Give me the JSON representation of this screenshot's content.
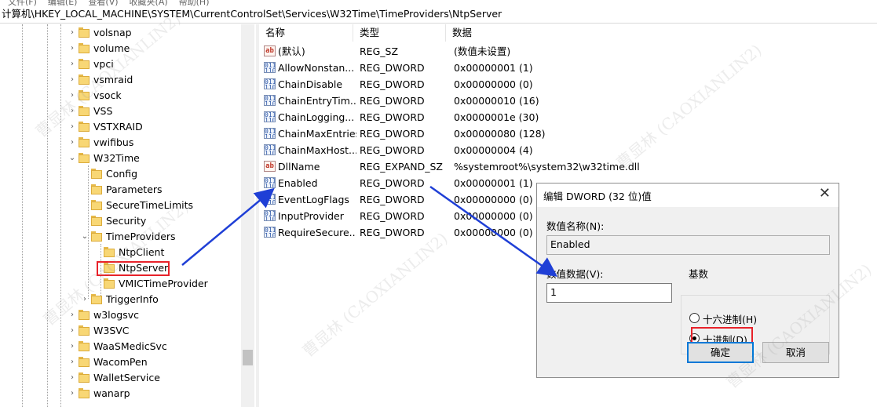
{
  "address": "计算机\\HKEY_LOCAL_MACHINE\\SYSTEM\\CurrentControlSet\\Services\\W32Time\\TimeProviders\\NtpServer",
  "menu": [
    "文件(F)",
    "编辑(E)",
    "查看(V)",
    "收藏夹(A)",
    "帮助(H)"
  ],
  "tree": {
    "items": [
      {
        "label": "volsnap"
      },
      {
        "label": "volume"
      },
      {
        "label": "vpci"
      },
      {
        "label": "vsmraid"
      },
      {
        "label": "vsock"
      },
      {
        "label": "VSS"
      },
      {
        "label": "VSTXRAID"
      },
      {
        "label": "vwifibus"
      },
      {
        "label": "W32Time"
      },
      {
        "label": "Config"
      },
      {
        "label": "Parameters"
      },
      {
        "label": "SecureTimeLimits"
      },
      {
        "label": "Security"
      },
      {
        "label": "TimeProviders"
      },
      {
        "label": "NtpClient"
      },
      {
        "label": "NtpServer"
      },
      {
        "label": "VMICTimeProvider"
      },
      {
        "label": "TriggerInfo"
      },
      {
        "label": "w3logsvc"
      },
      {
        "label": "W3SVC"
      },
      {
        "label": "WaaSMedicSvc"
      },
      {
        "label": "WacomPen"
      },
      {
        "label": "WalletService"
      },
      {
        "label": "wanarp"
      }
    ]
  },
  "list": {
    "headers": [
      "名称",
      "类型",
      "数据"
    ],
    "rows": [
      {
        "name": "(默认)",
        "type": "REG_SZ",
        "data": "(数值未设置)",
        "icon": "string-value-icon"
      },
      {
        "name": "AllowNonstan...",
        "type": "REG_DWORD",
        "data": "0x00000001 (1)",
        "icon": "binary-value-icon"
      },
      {
        "name": "ChainDisable",
        "type": "REG_DWORD",
        "data": "0x00000000 (0)",
        "icon": "binary-value-icon"
      },
      {
        "name": "ChainEntryTim...",
        "type": "REG_DWORD",
        "data": "0x00000010 (16)",
        "icon": "binary-value-icon"
      },
      {
        "name": "ChainLogging...",
        "type": "REG_DWORD",
        "data": "0x0000001e (30)",
        "icon": "binary-value-icon"
      },
      {
        "name": "ChainMaxEntries",
        "type": "REG_DWORD",
        "data": "0x00000080 (128)",
        "icon": "binary-value-icon"
      },
      {
        "name": "ChainMaxHost...",
        "type": "REG_DWORD",
        "data": "0x00000004 (4)",
        "icon": "binary-value-icon"
      },
      {
        "name": "DllName",
        "type": "REG_EXPAND_SZ",
        "data": "%systemroot%\\system32\\w32time.dll",
        "icon": "string-value-icon"
      },
      {
        "name": "Enabled",
        "type": "REG_DWORD",
        "data": "0x00000001 (1)",
        "icon": "binary-value-icon"
      },
      {
        "name": "EventLogFlags",
        "type": "REG_DWORD",
        "data": "0x00000000 (0)",
        "icon": "binary-value-icon"
      },
      {
        "name": "InputProvider",
        "type": "REG_DWORD",
        "data": "0x00000000 (0)",
        "icon": "binary-value-icon"
      },
      {
        "name": "RequireSecure...",
        "type": "REG_DWORD",
        "data": "0x00000000 (0)",
        "icon": "binary-value-icon"
      }
    ]
  },
  "dialog": {
    "title": "编辑 DWORD (32 位)值",
    "name_label": "数值名称(N):",
    "name_value": "Enabled",
    "data_label": "数值数据(V):",
    "data_value": "1",
    "base_label": "基数",
    "hex_label": "十六进制(H)",
    "dec_label": "十进制(D)",
    "ok": "确定",
    "cancel": "取消"
  },
  "icons": {
    "string": "ab",
    "binary": "011\n110",
    "close": "✕",
    "expand": "›",
    "collapse": "⌄"
  },
  "colors": {
    "highlight_box": "#e8222a",
    "arrow": "#1f3fd6",
    "default_button_border": "#0078d7"
  },
  "watermark": "曹显林 (CAOXIANLIN2)"
}
